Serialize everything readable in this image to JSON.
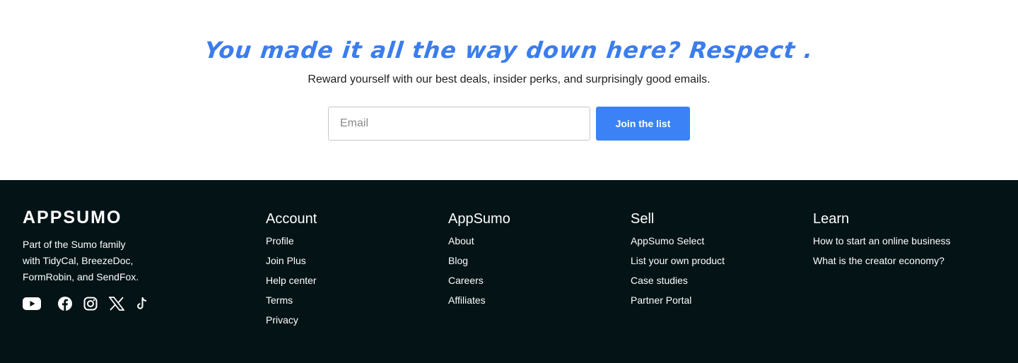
{
  "signup": {
    "headline": "You made it all the way down here? Respect .",
    "subline": "Reward yourself with our best deals, insider perks, and surprisingly good emails.",
    "email_placeholder": "Email",
    "button_label": "Join the list"
  },
  "footer": {
    "logo": "APPSUMO",
    "tagline_lines": [
      "Part of the Sumo family",
      "with TidyCal, BreezeDoc,",
      "FormRobin, and SendFox."
    ],
    "social_icons": [
      "youtube-icon",
      "facebook-icon",
      "instagram-icon",
      "x-icon",
      "tiktok-icon"
    ],
    "columns": [
      {
        "title": "Account",
        "links": [
          "Profile",
          "Join Plus",
          "Help center",
          "Terms",
          "Privacy"
        ]
      },
      {
        "title": "AppSumo",
        "links": [
          "About",
          "Blog",
          "Careers",
          "Affiliates"
        ]
      },
      {
        "title": "Sell",
        "links": [
          "AppSumo Select",
          "List your own product",
          "Case studies",
          "Partner Portal"
        ]
      },
      {
        "title": "Learn",
        "links": [
          "How to start an online business",
          "What is the creator economy?"
        ]
      }
    ]
  },
  "colors": {
    "accent": "#3b82f6",
    "headline": "#3b7ded",
    "footer_bg": "#031316"
  }
}
